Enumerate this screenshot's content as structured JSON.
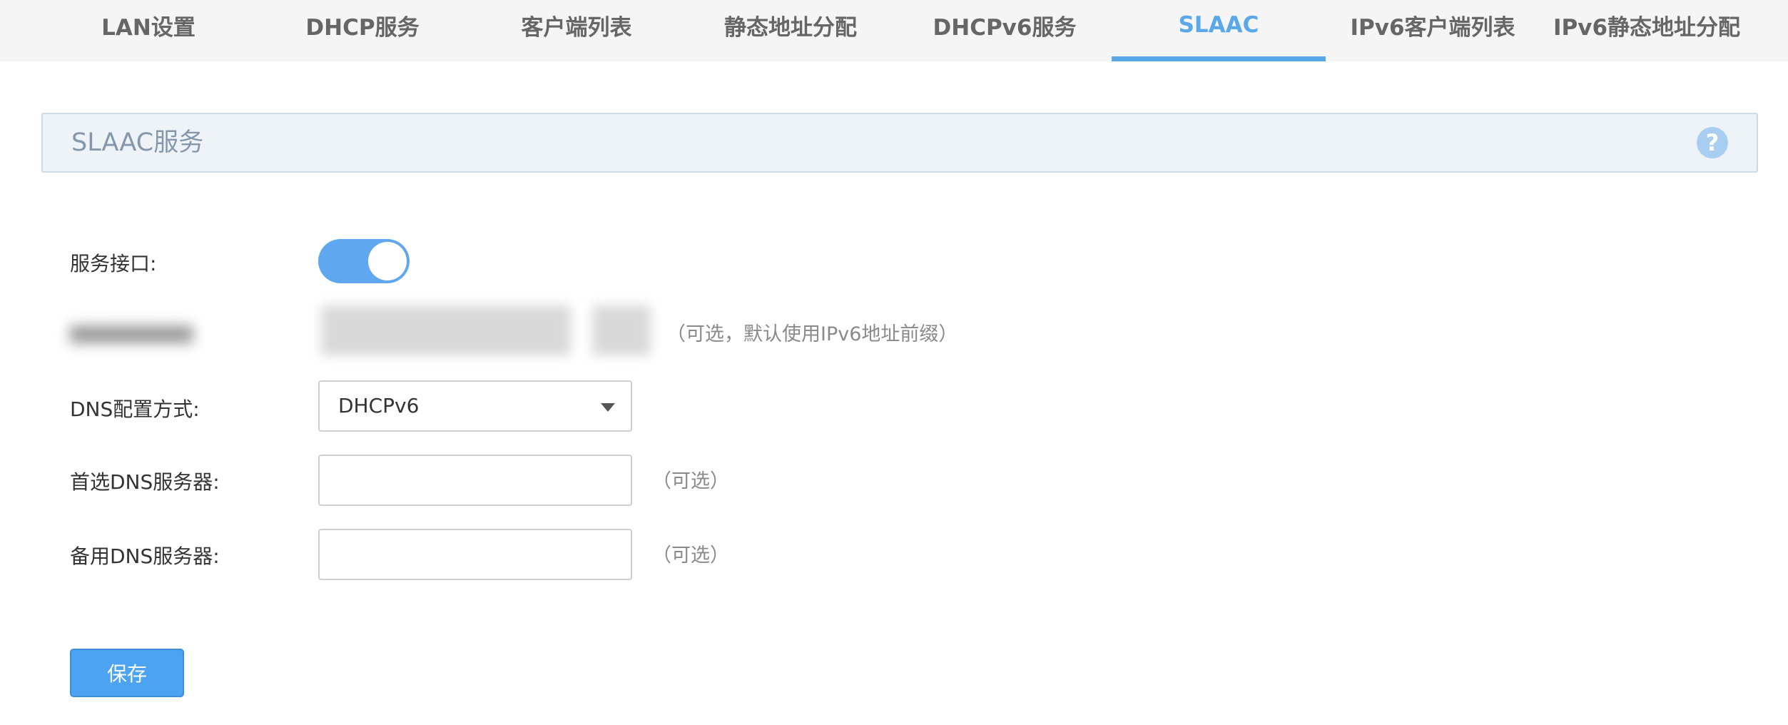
{
  "tabs": [
    {
      "label": "LAN设置",
      "active": false
    },
    {
      "label": "DHCP服务",
      "active": false
    },
    {
      "label": "客户端列表",
      "active": false
    },
    {
      "label": "静态地址分配",
      "active": false
    },
    {
      "label": "DHCPv6服务",
      "active": false
    },
    {
      "label": "SLAAC",
      "active": true
    },
    {
      "label": "IPv6客户端列表",
      "active": false
    },
    {
      "label": "IPv6静态地址分配",
      "active": false
    }
  ],
  "section": {
    "title": "SLAAC服务",
    "help_icon": "question-circle-icon"
  },
  "form": {
    "service_interface": {
      "label": "服务接口:",
      "enabled": true
    },
    "address_prefix": {
      "hint": "（可选，默认使用IPv6地址前缀）"
    },
    "dns_mode": {
      "label": "DNS配置方式:",
      "value": "DHCPv6"
    },
    "primary_dns": {
      "label": "首选DNS服务器:",
      "value": "",
      "hint": "（可选）"
    },
    "secondary_dns": {
      "label": "备用DNS服务器:",
      "value": "",
      "hint": "（可选）"
    }
  },
  "actions": {
    "save_label": "保存"
  },
  "colors": {
    "accent": "#5aa8ea",
    "button": "#4ba3f2",
    "header_bg": "#eef3f7"
  }
}
